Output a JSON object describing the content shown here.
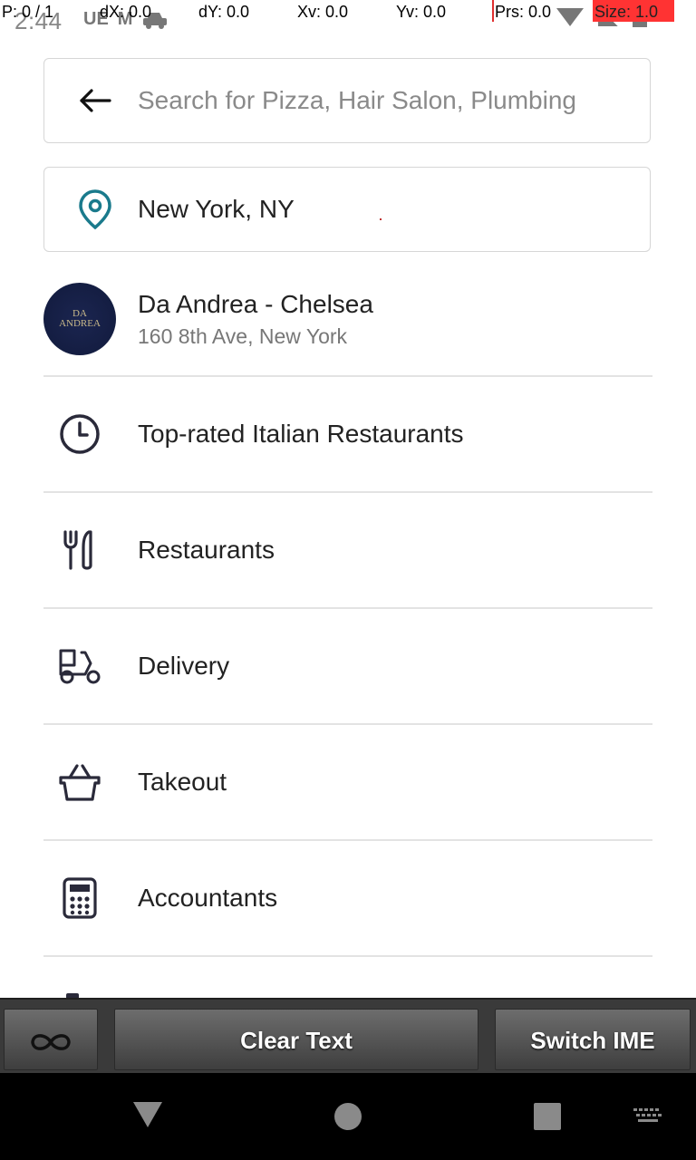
{
  "status_bar": {
    "time": "2:44",
    "left_icons": [
      "UE",
      "M"
    ]
  },
  "pointer_overlay": {
    "p": "P: 0 / 1",
    "dx": "dX: 0.0",
    "dy": "dY: 0.0",
    "xv": "Xv: 0.0",
    "yv": "Yv: 0.0",
    "prs": "Prs: 0.0",
    "size": "Size: 1.0"
  },
  "search": {
    "placeholder": "Search for Pizza, Hair Salon, Plumbing",
    "back_icon": "arrow-left-icon"
  },
  "location": {
    "value": "New York, NY",
    "icon": "location-pin-icon",
    "icon_color": "#1a7a8c"
  },
  "business_result": {
    "name": "Da Andrea - Chelsea",
    "address": "160 8th Ave, New York",
    "logo_text": [
      "DA",
      "ANDREA"
    ]
  },
  "suggestions": [
    {
      "label": "Top-rated Italian Restaurants",
      "icon": "clock-icon"
    },
    {
      "label": "Restaurants",
      "icon": "fork-knife-icon"
    },
    {
      "label": "Delivery",
      "icon": "scooter-icon"
    },
    {
      "label": "Takeout",
      "icon": "basket-icon"
    },
    {
      "label": "Accountants",
      "icon": "calculator-icon"
    }
  ],
  "ime_bar": {
    "loop_icon": "infinity-icon",
    "clear_label": "Clear Text",
    "switch_label": "Switch IME"
  },
  "nav_bar": {
    "icons": [
      "back-icon",
      "home-icon",
      "recents-icon",
      "keyboard-icon"
    ]
  }
}
